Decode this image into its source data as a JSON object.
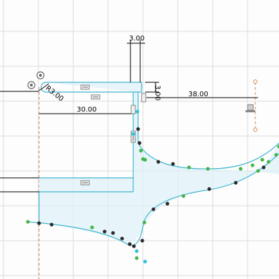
{
  "sketch": {
    "dimensions": {
      "width_top": "3.00",
      "radius": "R3.00",
      "span_left": "30.00",
      "span_right": "38.00",
      "thickness": "3.00"
    },
    "colors": {
      "profile_fill": "#dff0f8",
      "profile_stroke": "#3fb6cf",
      "dimension_line": "#000000",
      "grid_line": "#d9d9d9",
      "construction_line": "#d08a57",
      "point_green": "#43b549",
      "point_dark": "#2b2b2b",
      "point_cyan": "#31c3d7"
    },
    "icons": [
      "horizontal-constraint-icon",
      "vertical-constraint-icon",
      "fix-constraint-icon",
      "coincident-constraint-icon"
    ]
  }
}
